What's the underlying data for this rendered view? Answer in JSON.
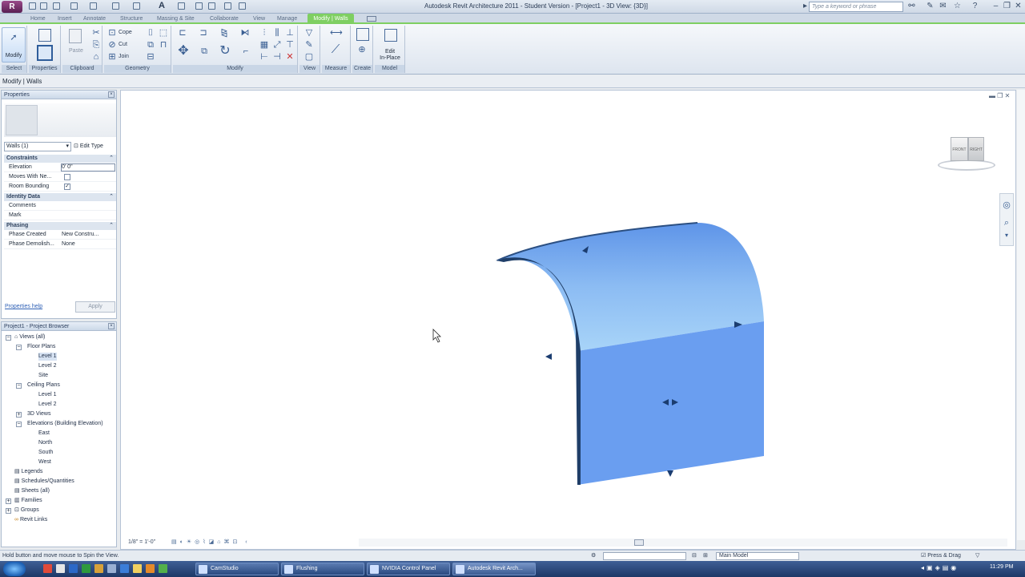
{
  "window": {
    "title": "Autodesk Revit Architecture 2011 - Student Version - [Project1 - 3D View: {3D}]",
    "app_button": "R",
    "search_placeholder": "Type a keyword or phrase"
  },
  "tabs": [
    "Home",
    "Insert",
    "Annotate",
    "Structure",
    "Massing & Site",
    "Collaborate",
    "View",
    "Manage"
  ],
  "active_tab": "Modify | Walls",
  "ribbon": {
    "modify_label": "Modify",
    "paste_label": "Paste",
    "cope_label": "Cope",
    "cut_label": "Cut",
    "join_label": "Join",
    "edit_inplace_label": "Edit\nIn-Place",
    "panels": [
      "Select",
      "Properties",
      "Clipboard",
      "Geometry",
      "Modify",
      "View",
      "Measure",
      "Create",
      "Model"
    ]
  },
  "context_bar": "Modify | Walls",
  "properties": {
    "title": "Properties",
    "type_selector": "Walls (1)",
    "edit_type": "Edit Type",
    "groups": {
      "constraints": "Constraints",
      "identity": "Identity Data",
      "phasing": "Phasing"
    },
    "rows": {
      "elevation": {
        "k": "Elevation",
        "v": "0'  0\""
      },
      "moves": {
        "k": "Moves With Ne...",
        "v": ""
      },
      "room": {
        "k": "Room Bounding",
        "v": "✓"
      },
      "comments": {
        "k": "Comments",
        "v": ""
      },
      "mark": {
        "k": "Mark",
        "v": ""
      },
      "phase_created": {
        "k": "Phase Created",
        "v": "New Constru..."
      },
      "phase_demolished": {
        "k": "Phase Demolish...",
        "v": "None"
      }
    },
    "help": "Properties help",
    "apply": "Apply"
  },
  "browser": {
    "title": "Project1 - Project Browser",
    "views": "Views (all)",
    "floor_plans": "Floor Plans",
    "fp": [
      "Level 1",
      "Level 2",
      "Site"
    ],
    "ceiling_plans": "Ceiling Plans",
    "cp": [
      "Level 1",
      "Level 2"
    ],
    "views3d": "3D Views",
    "elevations": "Elevations (Building Elevation)",
    "el": [
      "East",
      "North",
      "South",
      "West"
    ],
    "legends": "Legends",
    "schedules": "Schedules/Quantities",
    "sheets": "Sheets (all)",
    "families": "Families",
    "groups": "Groups",
    "links": "Revit Links"
  },
  "viewcube": {
    "front": "FRONT",
    "right": "RIGHT"
  },
  "view_controls": {
    "scale": "1/8\" = 1'-0\""
  },
  "status": {
    "text": "Hold button and move mouse to Spin the View.",
    "design_option": "Main Model",
    "press_drag": "Press & Drag"
  },
  "taskbar": {
    "items": [
      "CamStudio",
      "Flushing",
      "NVIDIA Control Panel",
      "Autodesk Revit Arch..."
    ],
    "clock": "11:29 PM"
  },
  "colors": {
    "accent": "#7fcf62",
    "wall": "#6a9ef0"
  }
}
